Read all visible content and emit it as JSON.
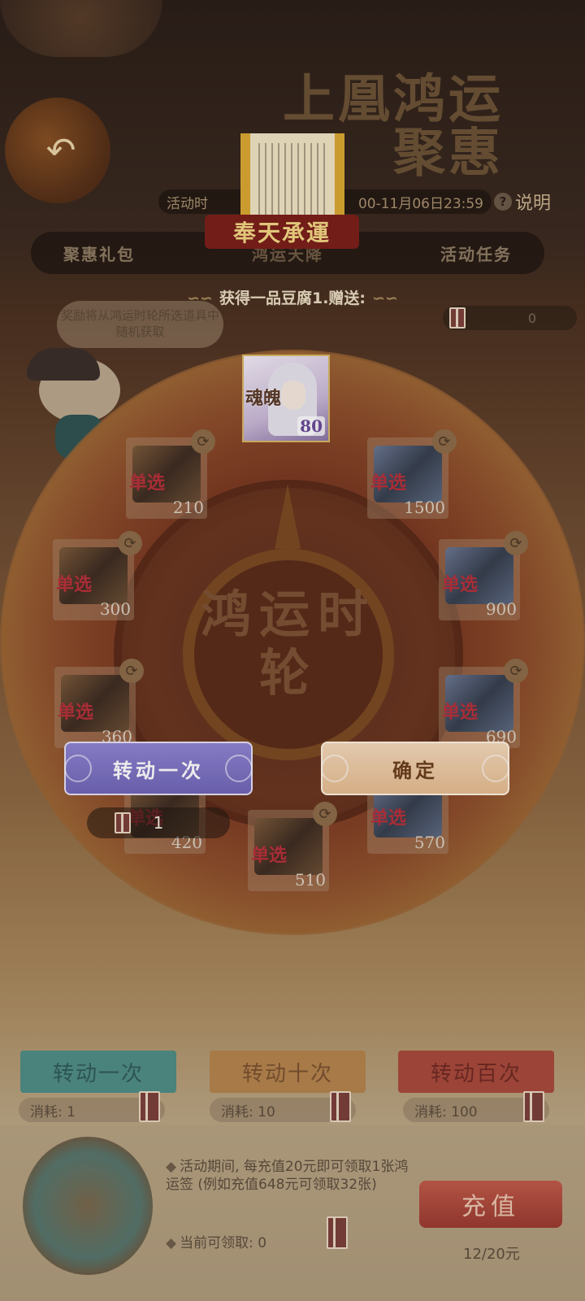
{
  "header": {
    "title_line1": "上凰鸿运",
    "title_line2": "聚惠",
    "period_prefix": "活动时",
    "period_suffix": "00-11月06日23:59",
    "help_label": "说明",
    "scroll_banner": "奉天承運"
  },
  "tabs": [
    {
      "label": "聚惠礼包"
    },
    {
      "label": "鸿运天降"
    },
    {
      "label": "活动任务"
    }
  ],
  "reward": {
    "title": "获得一品豆腐1.赠送:",
    "ticket_count": "0"
  },
  "hint": "奖励将从鸿运时轮所选道具中随机获取",
  "wheel": {
    "center_text": "鸿运时轮",
    "card": {
      "label": "魂魄",
      "count": "80"
    },
    "slots": [
      {
        "tag": "单选",
        "count": "210",
        "style": "brown"
      },
      {
        "tag": "单选",
        "count": "1500",
        "style": "blue"
      },
      {
        "tag": "单选",
        "count": "300",
        "style": "brown"
      },
      {
        "tag": "单选",
        "count": "900",
        "style": "blue"
      },
      {
        "tag": "单选",
        "count": "360",
        "style": "brown"
      },
      {
        "tag": "单选",
        "count": "690",
        "style": "blue"
      },
      {
        "tag": "单选",
        "count": "420",
        "style": "brown"
      },
      {
        "tag": "单选",
        "count": "570",
        "style": "blue"
      },
      {
        "tag": "单选",
        "count": "510",
        "style": "brown"
      }
    ]
  },
  "modal": {
    "spin_once": "转动一次",
    "confirm": "确定",
    "ticket_count": "1"
  },
  "spin_buttons": [
    {
      "label": "转动一次",
      "cost": "消耗: 1"
    },
    {
      "label": "转动十次",
      "cost": "消耗: 10"
    },
    {
      "label": "转动百次",
      "cost": "消耗: 100"
    }
  ],
  "bottom": {
    "notice": "活动期间, 每充值20元即可领取1张鸿运签 (例如充值648元可领取32张)",
    "claim": "当前可领取: 0",
    "recharge": "充值",
    "progress": "12/20元"
  }
}
